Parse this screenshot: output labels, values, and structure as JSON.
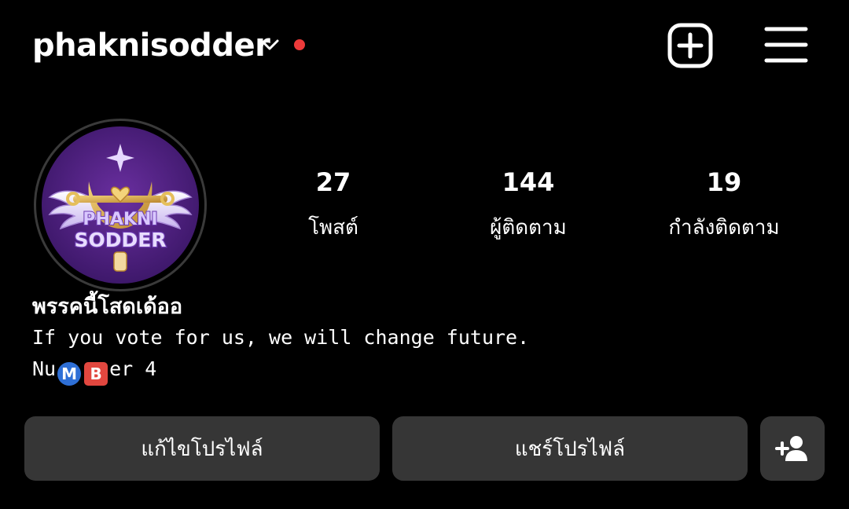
{
  "header": {
    "username": "phaknisodder",
    "icons": {
      "dropdown": "chevron-down-icon",
      "notification": "red-dot",
      "create": "plus-square-icon",
      "menu": "hamburger-menu-icon"
    },
    "notification_color": "#ed3a3a"
  },
  "profile": {
    "avatar_logo_text": [
      "PHAKNI",
      "SODDER"
    ],
    "stats": [
      {
        "value": "27",
        "label": "โพสต์"
      },
      {
        "value": "144",
        "label": "ผู้ติดตาม"
      },
      {
        "value": "19",
        "label": "กำลังติดตาม"
      }
    ],
    "display_name": "พรรคนี้โสดเด้ออ",
    "bio_line1": "If you vote for us, we will change future.",
    "bio_line2": {
      "prefix": "Nu",
      "emoji_m": "M",
      "emoji_b": "B",
      "suffix": "er 4"
    }
  },
  "actions": {
    "edit_profile": "แก้ไขโปรไฟล์",
    "share_profile": "แชร์โปรไฟล์",
    "add_friend_icon": "add-person-icon"
  },
  "colors": {
    "background": "#000000",
    "button": "#363636",
    "avatar_bg": "#4a1f78"
  }
}
